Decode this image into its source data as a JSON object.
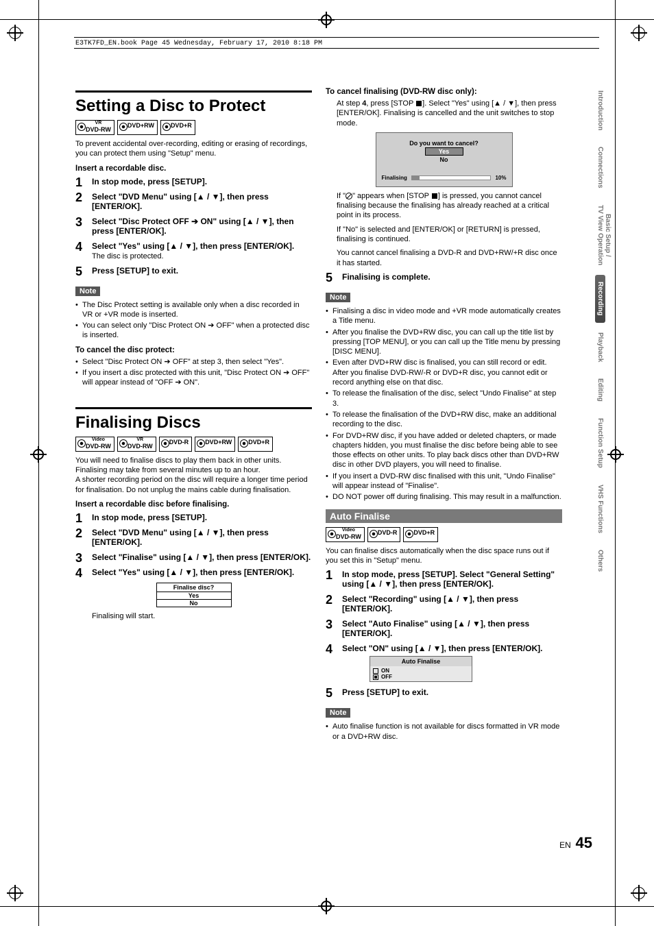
{
  "header": "E3TK7FD_EN.book  Page 45  Wednesday, February 17, 2010  8:18 PM",
  "s1": {
    "title": "Setting a Disc to Protect",
    "badges": [
      {
        "sup": "VR",
        "label": "DVD-RW"
      },
      {
        "sup": "",
        "label": "DVD+RW"
      },
      {
        "sup": "",
        "label": "DVD+R"
      }
    ],
    "intro": "To prevent accidental over-recording, editing or erasing of recordings, you can protect them using \"Setup\" menu.",
    "insert": "Insert a recordable disc.",
    "steps": [
      "In stop mode, press [SETUP].",
      "Select \"DVD Menu\" using [▲ / ▼], then press [ENTER/OK].",
      "Select \"Disc Protect OFF ➔ ON\" using [▲ / ▼], then press [ENTER/OK].",
      "Select \"Yes\" using [▲ / ▼], then press [ENTER/OK].",
      "Press [SETUP] to exit."
    ],
    "step4_sub": "The disc is protected.",
    "note_label": "Note",
    "notes": [
      "The Disc Protect setting is available only when a disc recorded in VR or +VR mode is inserted.",
      "You can select only \"Disc Protect ON ➔ OFF\" when a protected disc is inserted."
    ],
    "cancel_hdr": "To cancel the disc protect:",
    "cancel_bullets": [
      "Select \"Disc Protect ON ➔ OFF\" at step 3, then select \"Yes\".",
      "If you insert a disc protected with this unit, \"Disc Protect ON ➔ OFF\" will appear instead of \"OFF ➔ ON\"."
    ]
  },
  "s2": {
    "title": "Finalising Discs",
    "badges": [
      {
        "sup": "Video",
        "label": "DVD-RW"
      },
      {
        "sup": "VR",
        "label": "DVD-RW"
      },
      {
        "sup": "",
        "label": "DVD-R"
      },
      {
        "sup": "",
        "label": "DVD+RW"
      },
      {
        "sup": "",
        "label": "DVD+R"
      }
    ],
    "intro": "You will need to finalise discs to play them back in other units. Finalising may take from several minutes up to an hour.\nA shorter recording period on the disc will require a longer time period for finalisation. Do not unplug the mains cable during finalisation.",
    "insert": "Insert a recordable disc before finalising.",
    "steps": [
      "In stop mode, press [SETUP].",
      "Select \"DVD Menu\" using [▲ / ▼], then press [ENTER/OK].",
      "Select \"Finalise\" using [▲ / ▼], then press [ENTER/OK].",
      "Select \"Yes\" using [▲ / ▼], then press [ENTER/OK]."
    ],
    "dialog": {
      "title": "Finalise disc?",
      "opts": [
        "Yes",
        "No"
      ]
    },
    "after": "Finalising will start."
  },
  "s3": {
    "cancel_hdr": "To cancel finalising (DVD-RW disc only):",
    "cancel_line_a": "At step ",
    "cancel_step": "4",
    "cancel_line_b": ", press [STOP ",
    "cancel_line_c": "]. Select \"Yes\" using [▲ / ▼], then press [ENTER/OK]. Finalising is cancelled and the unit switches to stop mode.",
    "osd": {
      "q": "Do you want to cancel?",
      "yes": "Yes",
      "no": "No",
      "bar_label": "Finalising",
      "pct": "10%"
    },
    "p_noentry_a": "If \"",
    "p_noentry_b": "\" appears when [STOP ",
    "p_noentry_c": "] is pressed, you cannot cancel finalising because the finalising has already reached at a critical point in its process.",
    "p_ifno": "If \"No\" is selected and [ENTER/OK] or [RETURN] is pressed, finalising is continued.",
    "p_nocancel": "You cannot cancel finalising a DVD-R and DVD+RW/+R disc once it has started.",
    "step5": "Finalising is complete.",
    "note_label": "Note",
    "notes": [
      "Finalising a disc in video mode and +VR mode automatically creates a Title menu.",
      "After you finalise the DVD+RW disc, you can call up the title list by pressing [TOP MENU], or you can call up the Title menu by pressing [DISC MENU].",
      "Even after DVD+RW disc is finalised, you can still record or edit. After you finalise DVD-RW/-R or DVD+R disc, you cannot edit or record anything else on that disc.",
      "To release the finalisation of the disc, select \"Undo Finalise\" at step 3.",
      "To release the finalisation of the DVD+RW disc, make an additional recording to the disc.",
      "For DVD+RW disc, if you have added or deleted chapters, or made chapters hidden, you must finalise the disc before being able to see those effects on other units. To play back discs other than DVD+RW disc in other DVD players, you will need to finalise.",
      "If you insert a DVD-RW disc finalised with this unit, \"Undo Finalise\" will appear instead of \"Finalise\".",
      "DO NOT power off during finalising. This may result in a malfunction."
    ]
  },
  "s4": {
    "bar": "Auto Finalise",
    "badges": [
      {
        "sup": "Video",
        "label": "DVD-RW"
      },
      {
        "sup": "",
        "label": "DVD-R"
      },
      {
        "sup": "",
        "label": "DVD+R"
      }
    ],
    "intro": "You can finalise discs automatically when the disc space runs out if you set this in \"Setup\" menu.",
    "steps": [
      "In stop mode, press [SETUP]. Select \"General Setting\" using [▲ / ▼], then press [ENTER/OK].",
      "Select \"Recording\" using [▲ / ▼], then press [ENTER/OK].",
      "Select \"Auto Finalise\" using [▲ / ▼], then press [ENTER/OK].",
      "Select \"ON\" using [▲ / ▼], then press [ENTER/OK].",
      "Press [SETUP] to exit."
    ],
    "osd": {
      "title": "Auto Finalise",
      "on": "ON",
      "off": "OFF"
    },
    "note_label": "Note",
    "notes": [
      "Auto finalise function is not available for discs formatted in VR mode or a DVD+RW disc."
    ]
  },
  "footer": {
    "lang": "EN",
    "page": "45"
  },
  "tabs": [
    "Introduction",
    "Connections",
    "Basic Setup /\nTV View Operation",
    "Recording",
    "Playback",
    "Editing",
    "Function Setup",
    "VHS Functions",
    "Others"
  ]
}
